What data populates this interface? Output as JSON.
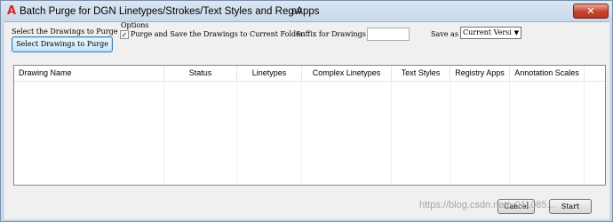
{
  "window": {
    "title": "Batch Purge for DGN Linetypes/Strokes/Text Styles and Reg Apps",
    "title_extra": "av",
    "close_glyph": "✕"
  },
  "controls": {
    "select_label": "Select the Drawings to Purge",
    "select_button": "Select Drawings to Purge",
    "options_label": "Options",
    "purge_checkbox_label": "Purge and Save the Drawings to Current Folder",
    "purge_checked": true,
    "check_glyph": "✓",
    "suffix_label": "Suffix for Drawings",
    "suffix_value": "",
    "save_as_label": "Save as",
    "save_as_value": "Current Versi",
    "dropdown_glyph": "▼"
  },
  "table": {
    "columns": [
      "Drawing Name",
      "Status",
      "Linetypes",
      "Complex Linetypes",
      "Text Styles",
      "Registry Apps",
      "Annotation Scales"
    ],
    "rows": []
  },
  "footer": {
    "cancel_label": "Cancel",
    "start_label": "Start",
    "watermark": "https://blog.csdn.net/u011085..."
  }
}
